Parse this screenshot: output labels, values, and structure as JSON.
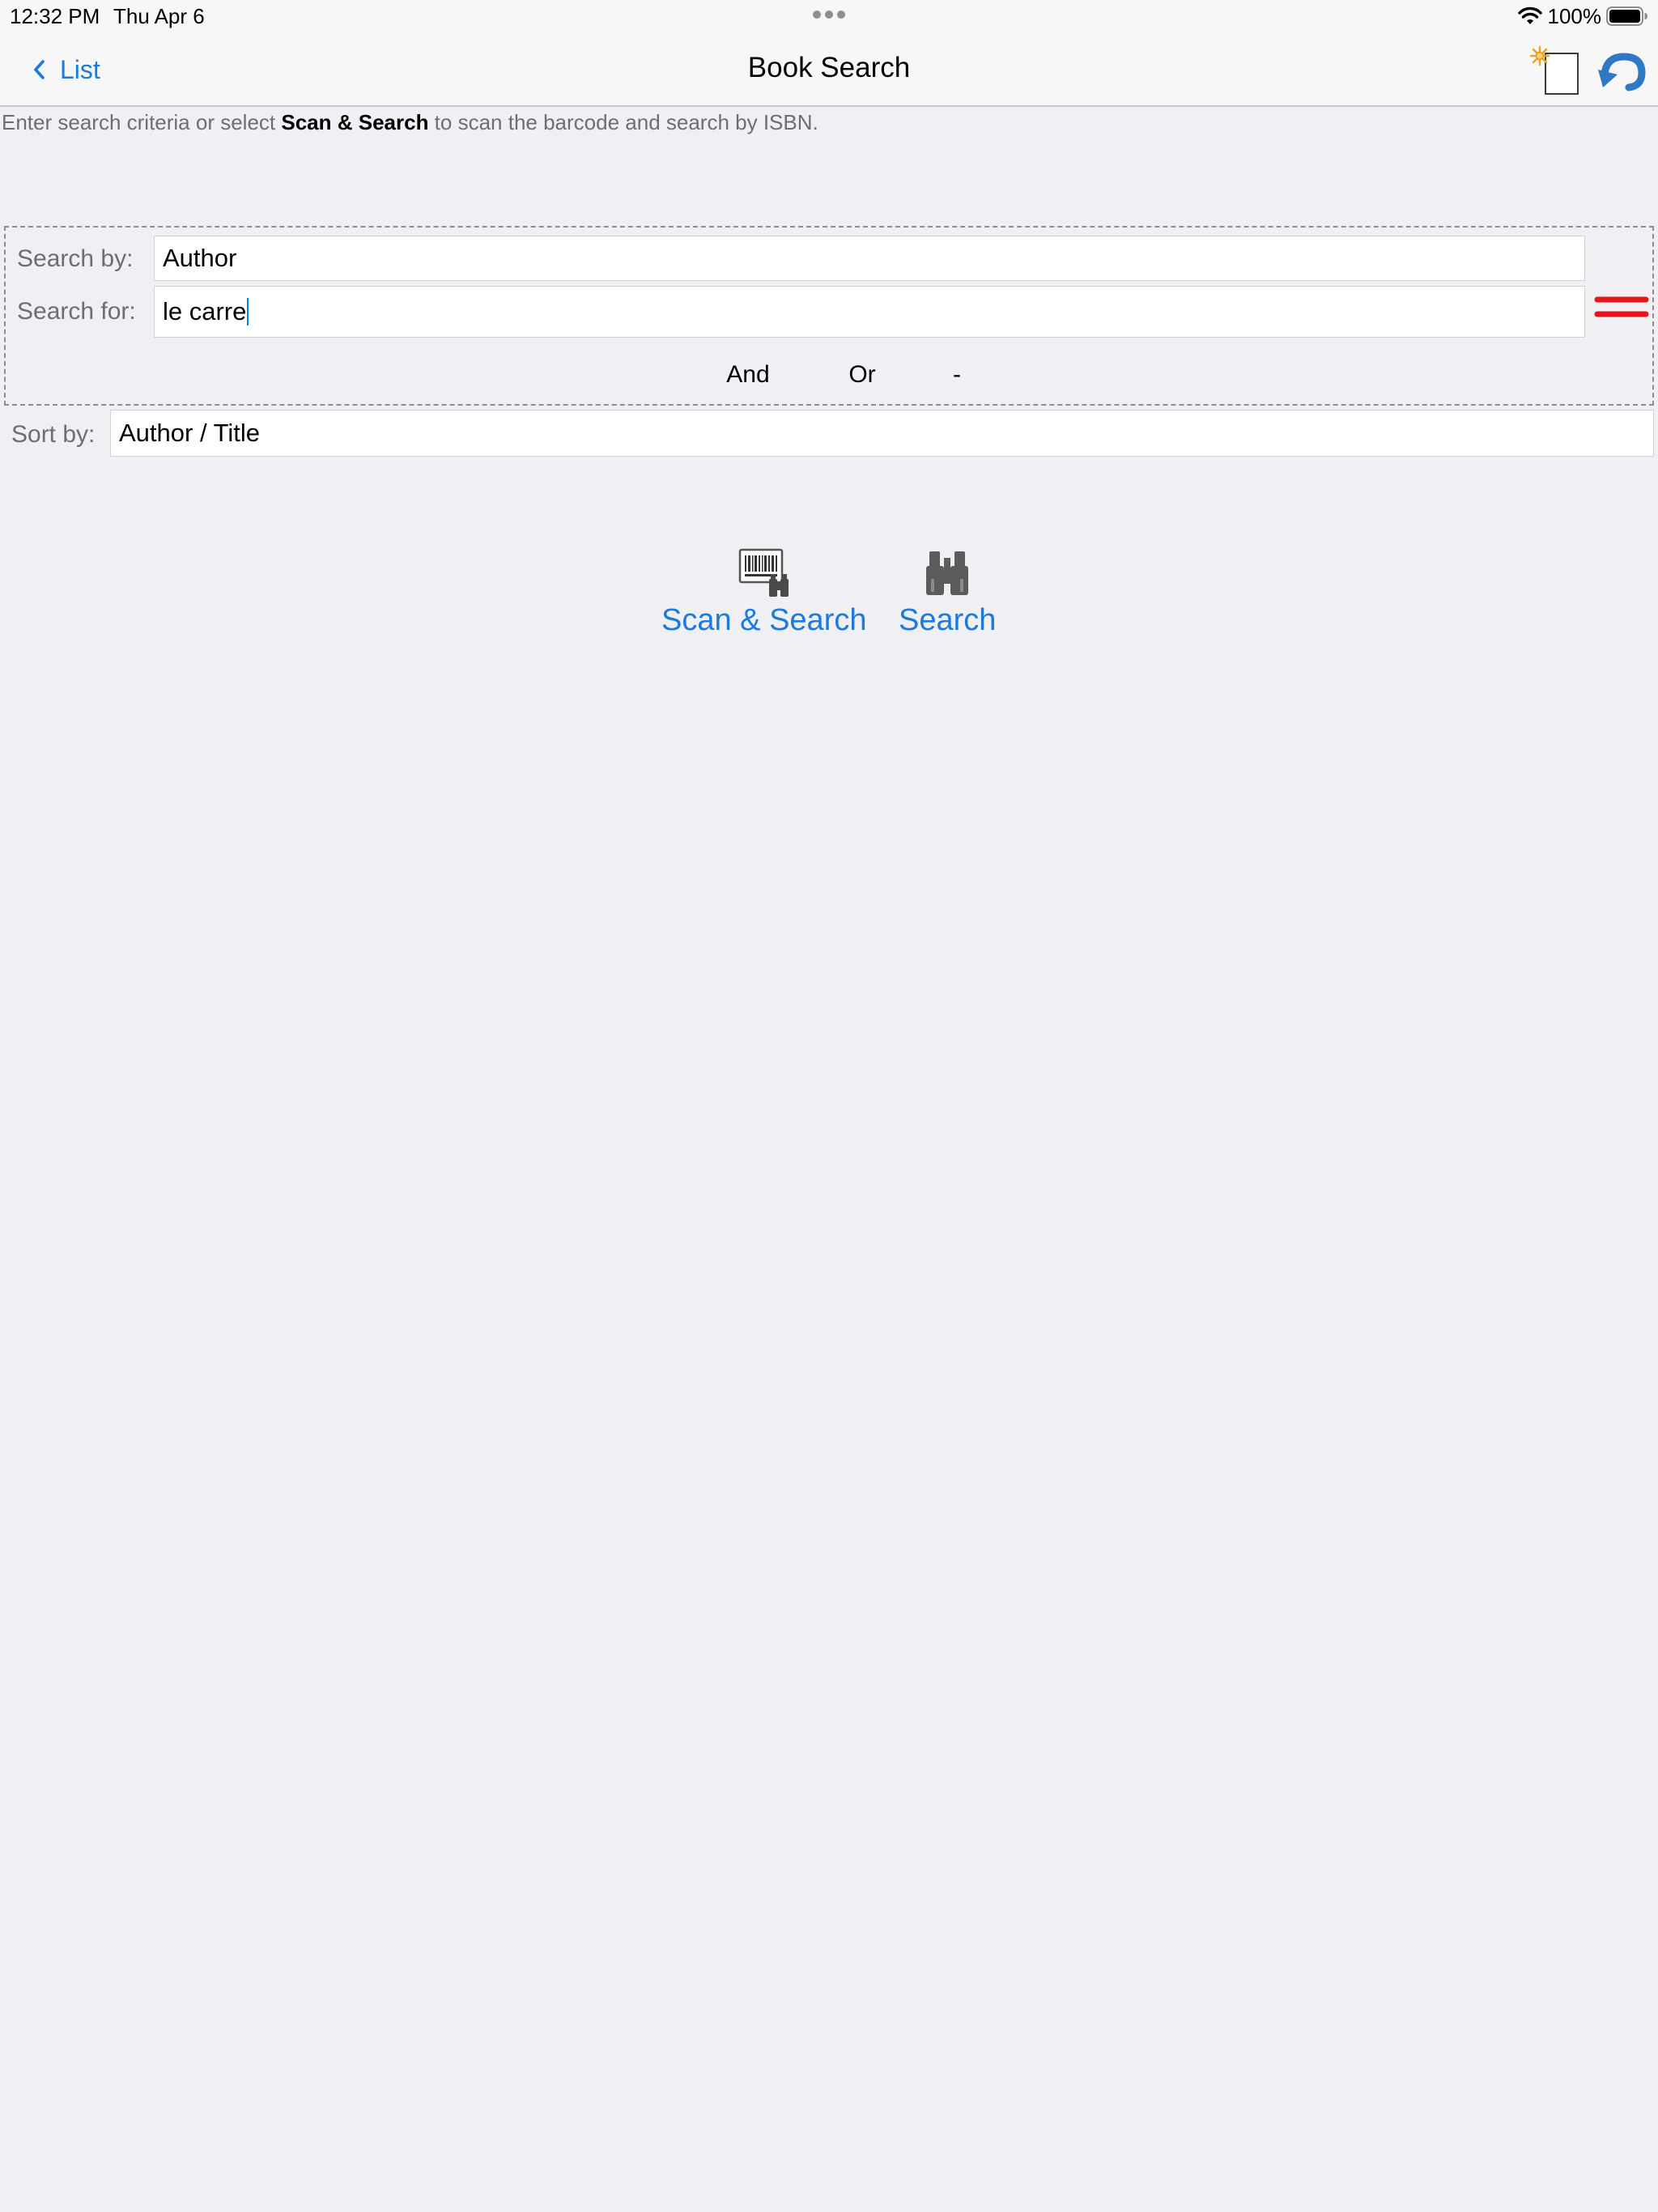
{
  "status_bar": {
    "time": "12:32 PM",
    "date": "Thu Apr 6",
    "battery": "100%"
  },
  "nav": {
    "back_label": "List",
    "title": "Book Search",
    "new_search_icon": "new-document-icon",
    "undo_icon": "undo-icon"
  },
  "instruction": {
    "before": "Enter search criteria or select ",
    "bold": "Scan & Search",
    "after": " to scan the barcode and search by ISBN."
  },
  "criteria": {
    "search_by_label": "Search by:",
    "search_by_value": "Author",
    "search_for_label": "Search for:",
    "search_for_value": "le carre",
    "operators": [
      "And",
      "Or",
      "-"
    ]
  },
  "sort": {
    "label": "Sort by:",
    "value": "Author / Title"
  },
  "actions": {
    "scan_search_label": "Scan & Search",
    "search_label": "Search"
  },
  "colors": {
    "accent": "#1a7ae0",
    "background": "#efeff4",
    "equals_icon": "#e8141c"
  }
}
